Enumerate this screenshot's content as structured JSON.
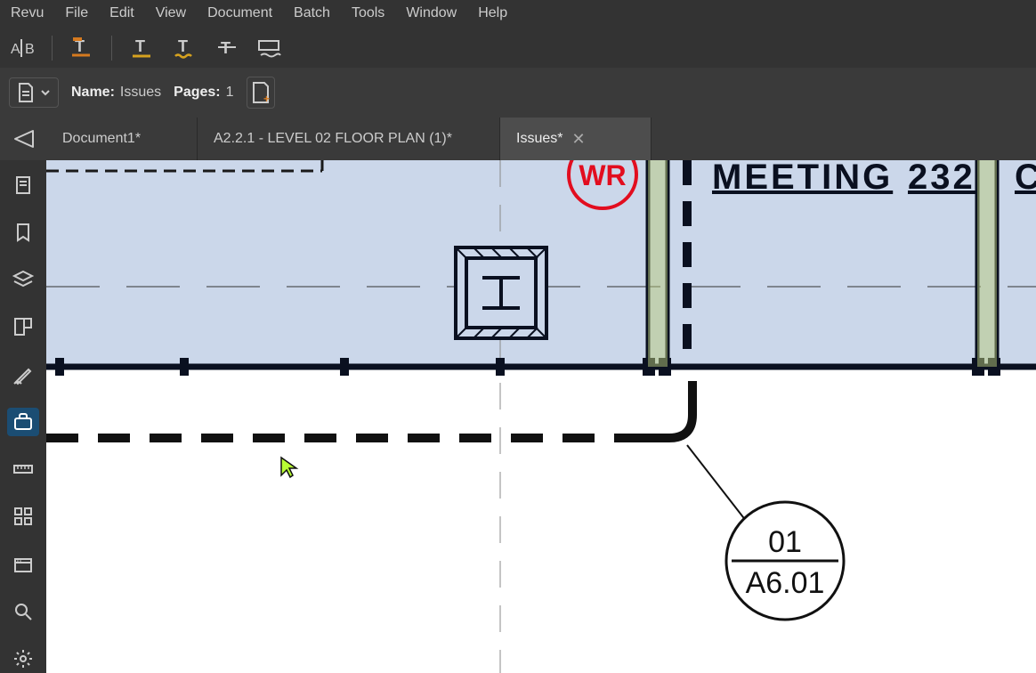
{
  "menu": {
    "items": [
      "Revu",
      "File",
      "Edit",
      "View",
      "Document",
      "Batch",
      "Tools",
      "Window",
      "Help"
    ]
  },
  "toolbar": {
    "compare_icon": "compare",
    "underline1_icon": "underline-orange",
    "underline2_icon": "underline-yellow",
    "underline3_icon": "underline-squiggle",
    "strikethrough_icon": "strikethrough",
    "caret_icon": "insert-caret"
  },
  "props": {
    "name_label": "Name:",
    "name_value": "Issues",
    "pages_label": "Pages:",
    "pages_value": "1"
  },
  "tabs": {
    "items": [
      {
        "label": "Document1*"
      },
      {
        "label": "A2.2.1 - LEVEL 02 FLOOR PLAN (1)*"
      },
      {
        "label": "Issues*",
        "active": true
      }
    ]
  },
  "sidebar": {
    "items": [
      "file-access",
      "bookmarks",
      "layers",
      "spaces",
      "signatures",
      "toolchest",
      "measurements",
      "thumbnails",
      "sets",
      "search",
      "settings"
    ],
    "active_index": 5
  },
  "drawing": {
    "wr_label": "WR",
    "room_name": "MEETING",
    "room_number": "232",
    "partial_letter": "C",
    "callout_top": "01",
    "callout_bottom": "A6.01"
  }
}
